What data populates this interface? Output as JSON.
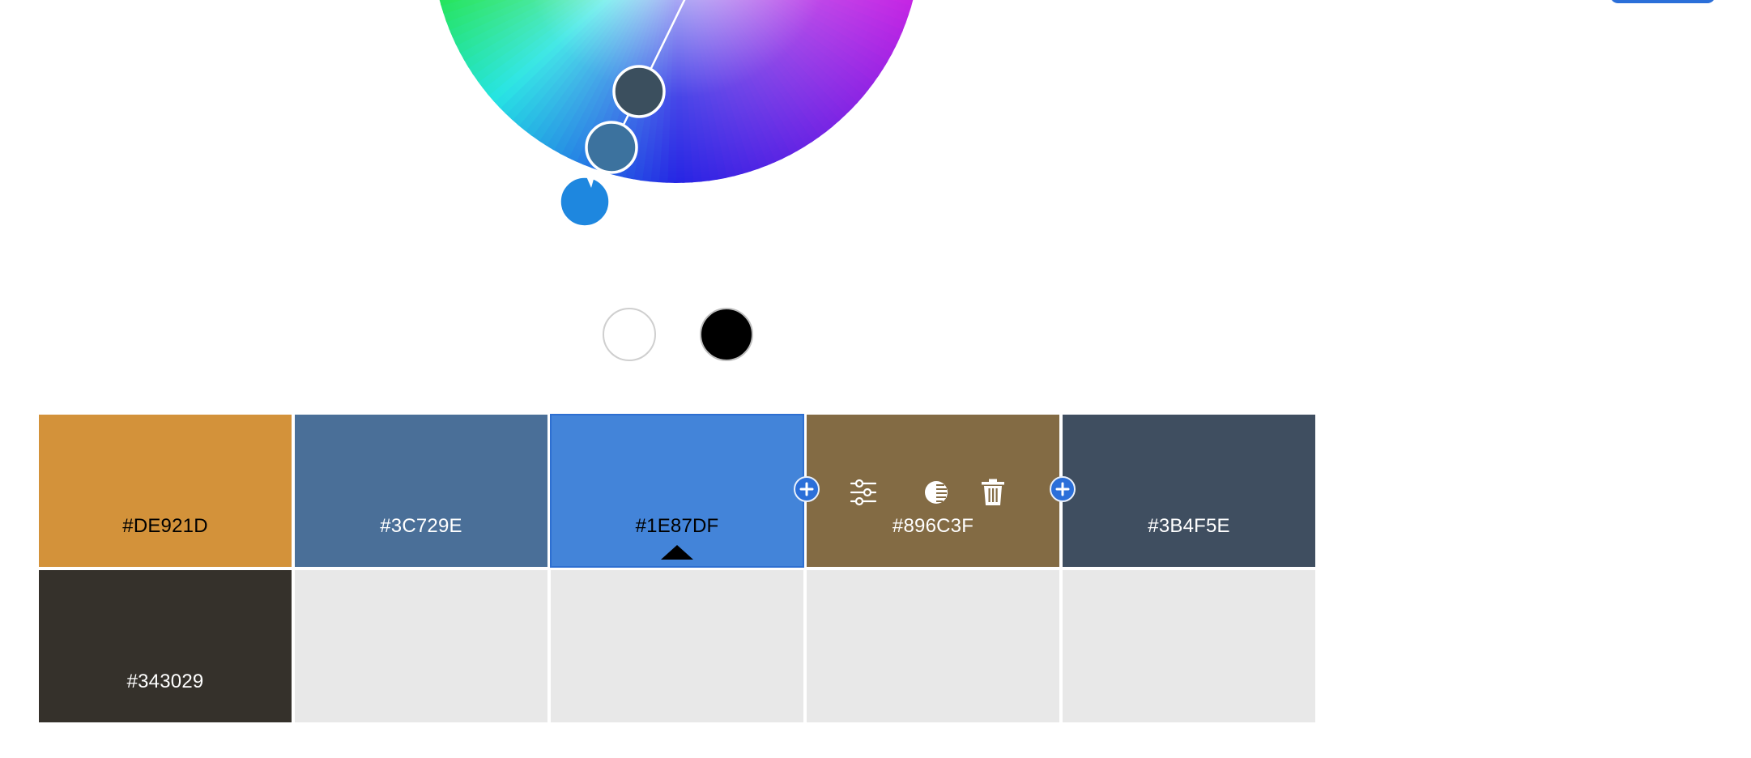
{
  "colors": {
    "accent": "#2b6fd9",
    "empty_cell": "#E8E8E8"
  },
  "wheel": {
    "handles": [
      {
        "hex": "#3B4F5E"
      },
      {
        "hex": "#3C729E"
      },
      {
        "hex": "#1E87DF",
        "active": true
      }
    ]
  },
  "quick_swatches": [
    {
      "name": "white",
      "hex": "#FFFFFF"
    },
    {
      "name": "black",
      "hex": "#000000"
    }
  ],
  "palette": {
    "row1": [
      {
        "hex_label": "#DE921D",
        "fill": "#D3923A",
        "text_color": "#000000"
      },
      {
        "hex_label": "#3C729E",
        "fill": "#4A6F98",
        "text_color": "#FFFFFF"
      },
      {
        "hex_label": "#1E87DF",
        "fill": "#4384D9",
        "text_color": "#000000",
        "selected": true
      },
      {
        "hex_label": "#896C3F",
        "fill": "#836B44",
        "text_color": "#FFFFFF"
      },
      {
        "hex_label": "#3B4F5E",
        "fill": "#3F4E60",
        "text_color": "#FFFFFF"
      }
    ],
    "row2": [
      {
        "hex_label": "#343029",
        "fill": "#35312B",
        "text_color": "#FFFFFF"
      },
      {
        "hex_label": "",
        "fill": "#E8E8E8"
      },
      {
        "hex_label": "",
        "fill": "#E8E8E8"
      },
      {
        "hex_label": "",
        "fill": "#E8E8E8"
      },
      {
        "hex_label": "",
        "fill": "#E8E8E8"
      }
    ]
  },
  "toolbar_icons": [
    "add-color-icon",
    "adjust-sliders-icon",
    "contrast-icon",
    "trash-icon",
    "add-color-icon"
  ]
}
